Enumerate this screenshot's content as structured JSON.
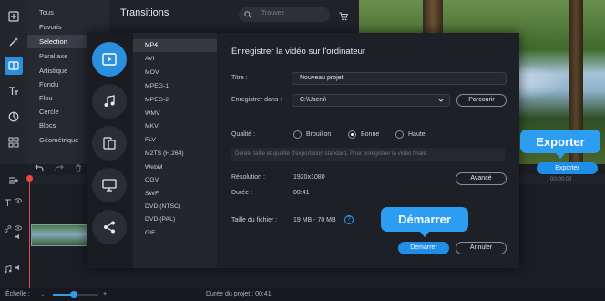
{
  "categories": {
    "items": [
      "Tous",
      "Favoris",
      "Sélection",
      "Parallaxe",
      "Artistique",
      "Fondu",
      "Flou",
      "Cercle",
      "Blocs",
      "Géométrique"
    ],
    "selected_index": 2
  },
  "transitions": {
    "title": "Transitions",
    "search_placeholder": "Trouvez"
  },
  "preview": {
    "export_label": "Exporter",
    "timecode": "00:00:00"
  },
  "callouts": {
    "export": "Exporter",
    "start": "Démarrer"
  },
  "dialog": {
    "title": "Enregistrer la vidéo sur l'ordinateur",
    "formats": [
      "MP4",
      "AVI",
      "MOV",
      "MPEG-1",
      "MPEG-2",
      "WMV",
      "MKV",
      "FLV",
      "M2TS (H.264)",
      "WebM",
      "OGV",
      "SWF",
      "DVD (NTSC)",
      "DVD (PAL)",
      "GIF"
    ],
    "selected_format_index": 0,
    "title_label": "Titre :",
    "title_value": "Nouveau projet",
    "save_in_label": "Enregistrer dans :",
    "save_in_value": "C:\\Users\\",
    "browse_label": "Parcourir",
    "quality_label": "Qualité :",
    "quality_options": [
      "Brouillon",
      "Bonne",
      "Haute"
    ],
    "quality_selected_index": 1,
    "quality_hint": "Durée, taille et qualité d'exportation standard. Pour enregistrer la vidéo finale.",
    "resolution_label": "Résolution :",
    "resolution_value": "1920x1080",
    "advanced_label": "Avancé",
    "duration_label": "Durée :",
    "duration_value": "00:41",
    "filesize_label": "Taille du fichier :",
    "filesize_value": "19 MB - 70 MB",
    "help_glyph": "?",
    "start_label": "Démarrer",
    "cancel_label": "Annuler"
  },
  "statusbar": {
    "zoom_label": "Échelle :",
    "zoom_level": 0.45,
    "project_duration": "Durée du projet : 00:41"
  },
  "colors": {
    "accent": "#1e8ee6",
    "callout": "#2c9df0",
    "playhead": "#e84a3c"
  }
}
